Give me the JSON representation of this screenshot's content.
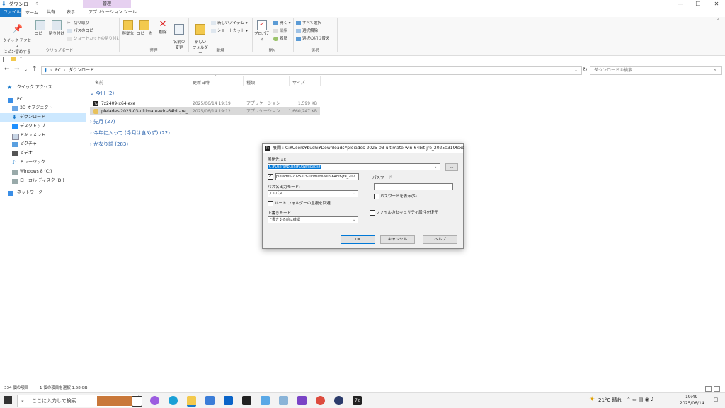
{
  "window": {
    "title": "ダウンロード",
    "minimize_icon": "—",
    "maximize_icon": "☐",
    "close_icon": "✕"
  },
  "ribbon_tabs": {
    "file": "ファイル",
    "home": "ホーム",
    "share": "共有",
    "view": "表示",
    "context_header": "管理",
    "context_tab": "アプリケーション ツール"
  },
  "clipboard": {
    "pin": "クイック アクセス\nにピン留めする",
    "copy": "コピー",
    "paste": "貼り付け",
    "cut": "切り取り",
    "copy_path": "パスのコピー",
    "paste_shortcut": "ショートカットの貼り付け",
    "group": "クリップボード"
  },
  "organize": {
    "move_to": "移動先",
    "copy_to": "コピー先",
    "delete": "削除",
    "rename": "名前の\n変更",
    "group": "整理"
  },
  "new": {
    "new_folder": "新しい\nフォルダー",
    "new_item": "新しいアイテム",
    "shortcut": "ショートカット",
    "group": "新規"
  },
  "open": {
    "properties": "プロパティ",
    "open": "開く",
    "edit": "編集",
    "history": "履歴",
    "group": "開く"
  },
  "select": {
    "select_all": "すべて選択",
    "select_none": "選択解除",
    "invert": "選択の切り替え",
    "group": "選択"
  },
  "address": {
    "pc": "PC",
    "folder": "ダウンロード",
    "sep": "›",
    "search_placeholder": "ダウンロードの検索"
  },
  "nav": {
    "quick_access": "クイック アクセス",
    "pc": "PC",
    "objects3d": "3D オブジェクト",
    "downloads": "ダウンロード",
    "desktop": "デスクトップ",
    "documents": "ドキュメント",
    "pictures": "ピクチャ",
    "videos": "ビデオ",
    "music": "ミュージック",
    "windows": "Windows 8 (C:)",
    "local": "ローカル ディスク (D:)",
    "network": "ネットワーク"
  },
  "columns": {
    "name": "名前",
    "date": "更新日時",
    "type": "種類",
    "size": "サイズ"
  },
  "groups": {
    "today": "今日 (2)",
    "last_month": "先月 (27)",
    "this_year": "今年に入って (今月は含めず) (22)",
    "long_ago": "かなり前 (283)"
  },
  "files": [
    {
      "name": "7z2409-x64.exe",
      "date": "2025/06/14 19:19",
      "type": "アプリケーション",
      "size": "1,599 KB"
    },
    {
      "name": "pleiades-2025-03-ultimate-win-64bit-jre_...",
      "date": "2025/06/14 19:12",
      "type": "アプリケーション",
      "size": "1,660,247 KB"
    }
  ],
  "dialog": {
    "title": "展開 : C:¥Users¥bushi¥Downloads¥pleiades-2025-03-ultimate-win-64bit-jre_20250319.exe",
    "dest_label": "展開先(X):",
    "dest_value": "C:¥Users¥bushi¥Downloads¥",
    "browse": "...",
    "folder_value": "pleiades-2025-03-ultimate-win-64bit-jre_202",
    "path_mode_label": "パス名出力モード:",
    "path_mode_value": "フルパス",
    "eliminate_root": "ルート フォルダーの重複を回避",
    "overwrite_label": "上書きモード",
    "overwrite_value": "上書きする前に確認",
    "password_label": "パスワード",
    "show_password": "パスワードを表示(S)",
    "restore_security": "ファイルのセキュリティ属性を復元",
    "ok": "OK",
    "cancel": "キャンセル",
    "help": "ヘルプ",
    "check": "✓"
  },
  "status": {
    "count": "334 個の項目",
    "selected": "1 個の項目を選択  1.58 GB"
  },
  "taskbar": {
    "search": "ここに入力して検索",
    "weather": "21°C 晴れ",
    "time": "19:49",
    "date": "2025/06/14"
  },
  "colors": {
    "accent": "#1979ca",
    "selection": "#cce8ff",
    "context": "#e6d0f0"
  }
}
